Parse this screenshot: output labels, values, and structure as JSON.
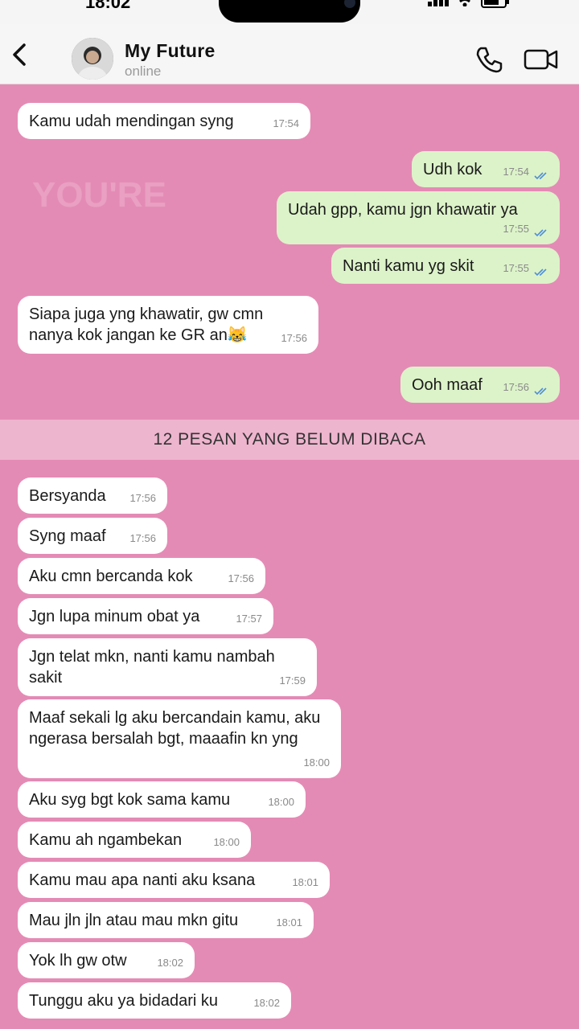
{
  "status_bar": {
    "time": "18:02"
  },
  "header": {
    "contact_name": "My Future",
    "contact_status": "online"
  },
  "watermark": "YOU'RE",
  "messages_before": [
    {
      "dir": "in",
      "text": "Kamu udah mendingan syng",
      "time": "17:54"
    },
    {
      "dir": "out",
      "text": "Udh kok",
      "time": "17:54",
      "read": true
    },
    {
      "dir": "out",
      "text": "Udah gpp, kamu jgn khawatir ya",
      "time": "17:55",
      "read": true
    },
    {
      "dir": "out",
      "text": "Nanti kamu yg skit",
      "time": "17:55",
      "read": true
    },
    {
      "dir": "in",
      "text": "Siapa juga yng khawatir, gw cmn nanya kok jangan ke GR an😹",
      "time": "17:56"
    },
    {
      "dir": "out",
      "text": "Ooh maaf",
      "time": "17:56",
      "read": true
    }
  ],
  "unread_banner": "12 PESAN YANG BELUM DIBACA",
  "messages_after": [
    {
      "dir": "in",
      "text": "Bersyanda",
      "time": "17:56"
    },
    {
      "dir": "in",
      "text": "Syng maaf",
      "time": "17:56"
    },
    {
      "dir": "in",
      "text": "Aku cmn bercanda kok",
      "time": "17:56"
    },
    {
      "dir": "in",
      "text": "Jgn lupa minum obat ya",
      "time": "17:57"
    },
    {
      "dir": "in",
      "text": "Jgn telat mkn, nanti kamu nambah sakit",
      "time": "17:59"
    },
    {
      "dir": "in",
      "text": "Maaf sekali lg aku bercandain kamu, aku ngerasa bersalah bgt, maaafin kn yng",
      "time": "18:00"
    },
    {
      "dir": "in",
      "text": "Aku syg bgt kok sama kamu",
      "time": "18:00"
    },
    {
      "dir": "in",
      "text": "Kamu ah ngambekan",
      "time": "18:00"
    },
    {
      "dir": "in",
      "text": "Kamu mau apa nanti aku ksana",
      "time": "18:01"
    },
    {
      "dir": "in",
      "text": "Mau jln jln atau mau mkn gitu",
      "time": "18:01"
    },
    {
      "dir": "in",
      "text": "Yok lh gw otw",
      "time": "18:02"
    },
    {
      "dir": "in",
      "text": "Tunggu aku ya bidadari ku",
      "time": "18:02"
    }
  ],
  "colors": {
    "chat_background": "#e48bb5",
    "incoming_bubble": "#ffffff",
    "outgoing_bubble": "#dcf3c9",
    "read_tick": "#4f8fd6"
  },
  "icons": [
    "back-chevron-icon",
    "phone-icon",
    "video-call-icon",
    "read-tick-icon"
  ]
}
